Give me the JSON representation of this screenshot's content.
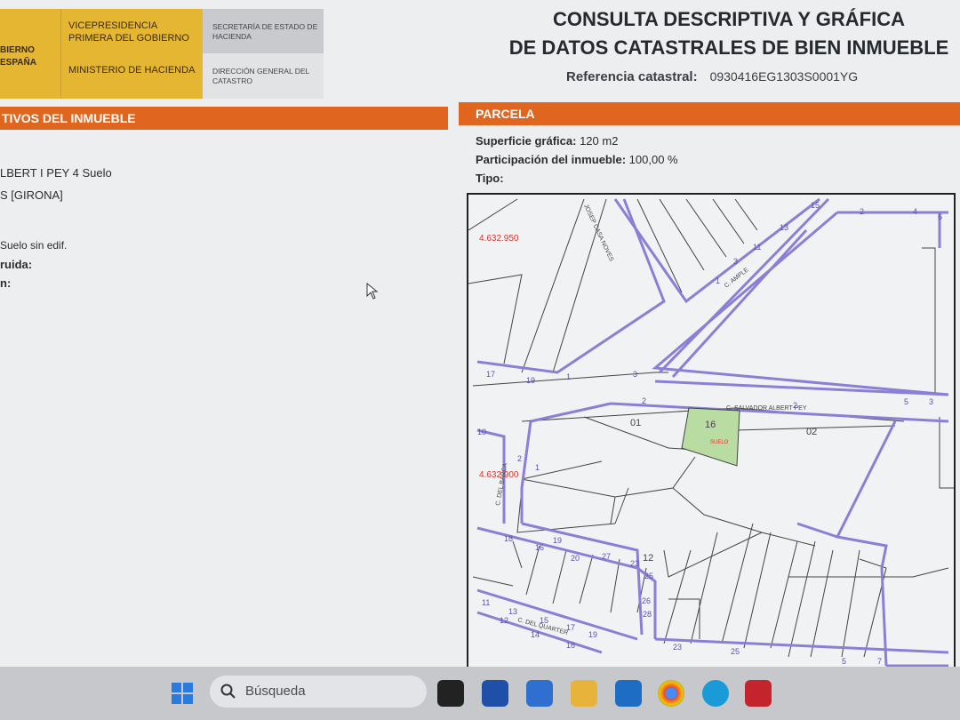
{
  "header": {
    "gov_lines": [
      "BIERNO",
      "ESPAÑA"
    ],
    "vicepresidencia": "VICEPRESIDENCIA PRIMERA DEL GOBIERNO",
    "ministerio": "MINISTERIO DE HACIENDA",
    "secretaria": "SECRETARÍA DE ESTADO DE HACIENDA",
    "direccion": "DIRECCIÓN GENERAL DEL CATASTRO",
    "title_line1": "CONSULTA DESCRIPTIVA Y GRÁFICA",
    "title_line2": "DE DATOS CATASTRALES DE BIEN INMUEBLE",
    "ref_label": "Referencia catastral:",
    "ref_value": "0930416EG1303S0001YG"
  },
  "left": {
    "section_title": "TIVOS DEL INMUEBLE",
    "lines": [
      "LBERT I PEY 4 Suelo",
      "S [GIRONA]",
      "Suelo sin edif.",
      "ruida:",
      "n:"
    ]
  },
  "parcela": {
    "section_title": "PARCELA",
    "superficie_label": "Superficie gráfica:",
    "superficie_value": "120 m2",
    "participacion_label": "Participación del inmueble:",
    "participacion_value": "100,00 %",
    "tipo_label": "Tipo:"
  },
  "map": {
    "coord_top": "4.632.950",
    "coord_mid": "4.632.900",
    "street_salvador": "C. SALVADOR ALBERT PEY",
    "street_ample": "C. AMPLE",
    "street_quarter": "C. DEL QUARTER",
    "street_barca": "C. DEL BARCA",
    "street_joan": "JOSEP CASA NOVES",
    "parcel_01": "01",
    "parcel_02": "02",
    "parcel_16": "16",
    "parcel_12": "12",
    "suelo": "SUELO",
    "nums": [
      "2",
      "4",
      "6",
      "15",
      "13",
      "11",
      "3",
      "1",
      "17",
      "19",
      "1",
      "2",
      "2",
      "10",
      "5",
      "3",
      "18",
      "16",
      "19",
      "20",
      "27",
      "23",
      "25",
      "26",
      "28",
      "11",
      "13",
      "15",
      "17",
      "19",
      "12",
      "14",
      "16",
      "23",
      "25",
      "5",
      "7",
      "3",
      "1",
      "2"
    ],
    "colors": {
      "street": "#8a7fd6",
      "highlight": "#b9dca3",
      "parcel_line": "#444",
      "coord": "#d9342b"
    }
  },
  "taskbar": {
    "search_placeholder": "Búsqueda"
  },
  "colors": {
    "orange": "#e0661f",
    "gold": "#e5b632"
  }
}
